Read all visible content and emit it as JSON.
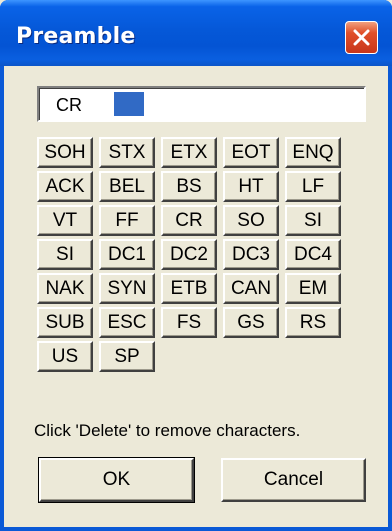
{
  "window": {
    "title": "Preamble"
  },
  "icons": {
    "close": "close-x-icon"
  },
  "field": {
    "value": "CR"
  },
  "keys": [
    [
      "SOH",
      "STX",
      "ETX",
      "EOT",
      "ENQ"
    ],
    [
      "ACK",
      "BEL",
      "BS",
      "HT",
      "LF"
    ],
    [
      "VT",
      "FF",
      "CR",
      "SO",
      "SI"
    ],
    [
      "SI",
      "DC1",
      "DC2",
      "DC3",
      "DC4"
    ],
    [
      "NAK",
      "SYN",
      "ETB",
      "CAN",
      "EM"
    ],
    [
      "SUB",
      "ESC",
      "FS",
      "GS",
      "RS"
    ],
    [
      "US",
      "SP"
    ]
  ],
  "hint": "Click 'Delete' to remove characters.",
  "buttons": {
    "ok": "OK",
    "cancel": "Cancel"
  },
  "colors": {
    "titlebar": "#0558d8",
    "close": "#e0502a",
    "selection": "#316ac5",
    "face": "#ece9d8"
  }
}
